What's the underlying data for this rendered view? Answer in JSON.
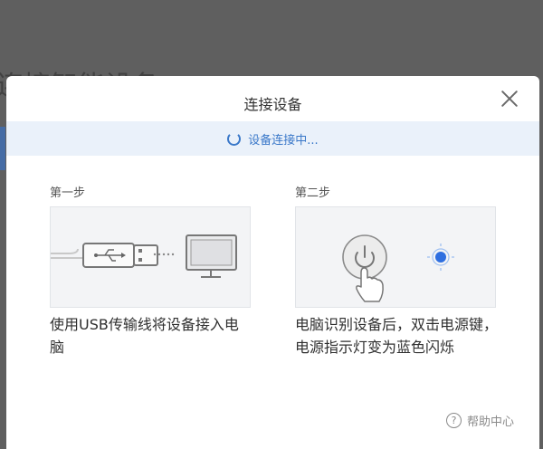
{
  "background": {
    "title": "连接智能设备"
  },
  "dialog": {
    "title": "连接设备",
    "close_icon": "close-icon",
    "status": {
      "text": "设备连接中...",
      "icon": "spinner-icon",
      "color": "#3a78c9",
      "bar_color": "#eaf1fa"
    },
    "steps": [
      {
        "label": "第一步",
        "description": "使用USB传输线将设备接入电脑",
        "illustration": "usb-to-computer"
      },
      {
        "label": "第二步",
        "description": "电脑识别设备后，双击电源键，电源指示灯变为蓝色闪烁",
        "illustration": "power-button-double-tap"
      }
    ],
    "help": {
      "label": "帮助中心",
      "icon": "question-circle-icon"
    }
  }
}
